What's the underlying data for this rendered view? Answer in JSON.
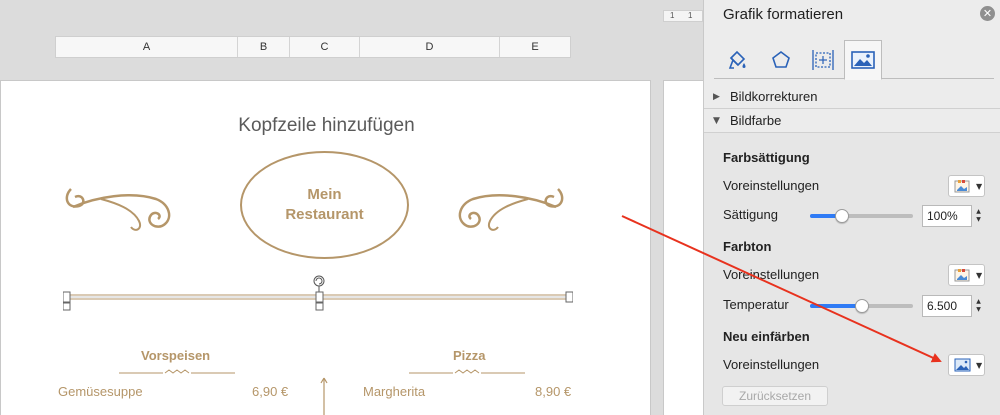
{
  "sheet": {
    "columns": [
      "A",
      "B",
      "C",
      "D",
      "E"
    ],
    "ruler_marks": [
      "1",
      "1"
    ],
    "header_placeholder": "Kopfzeile hinzufügen",
    "logo_line1": "Mein",
    "logo_line2": "Restaurant",
    "menu": {
      "left_heading": "Vorspeisen",
      "right_heading": "Pizza",
      "left_item": "Gemüsesuppe",
      "left_price": "6,90 €",
      "right_item": "Margherita",
      "right_price": "8,90 €"
    }
  },
  "panel": {
    "title": "Grafik formatieren",
    "close_glyph": "✕",
    "tabs": [
      {
        "name": "fill-line",
        "icon": "paint-bucket-icon"
      },
      {
        "name": "effects",
        "icon": "pentagon-icon"
      },
      {
        "name": "size-properties",
        "icon": "size-move-icon"
      },
      {
        "name": "picture",
        "icon": "picture-icon",
        "active": true
      }
    ],
    "sections": {
      "image_corrections": "Bildkorrekturen",
      "image_color": "Bildfarbe"
    },
    "saturation": {
      "title": "Farbsättigung",
      "presets_label": "Voreinstellungen",
      "value_label": "Sättigung",
      "value": "100%",
      "slider_fraction": 0.28
    },
    "tone": {
      "title": "Farbton",
      "presets_label": "Voreinstellungen",
      "value_label": "Temperatur",
      "value": "6.500",
      "slider_fraction": 0.5
    },
    "recolor": {
      "title": "Neu einfärben",
      "presets_label": "Voreinstellungen"
    },
    "reset_label": "Zurücksetzen"
  },
  "colors": {
    "accent_gold": "#b59669",
    "slider_blue": "#2f7bf5",
    "annotation_arrow": "#e8321e"
  }
}
